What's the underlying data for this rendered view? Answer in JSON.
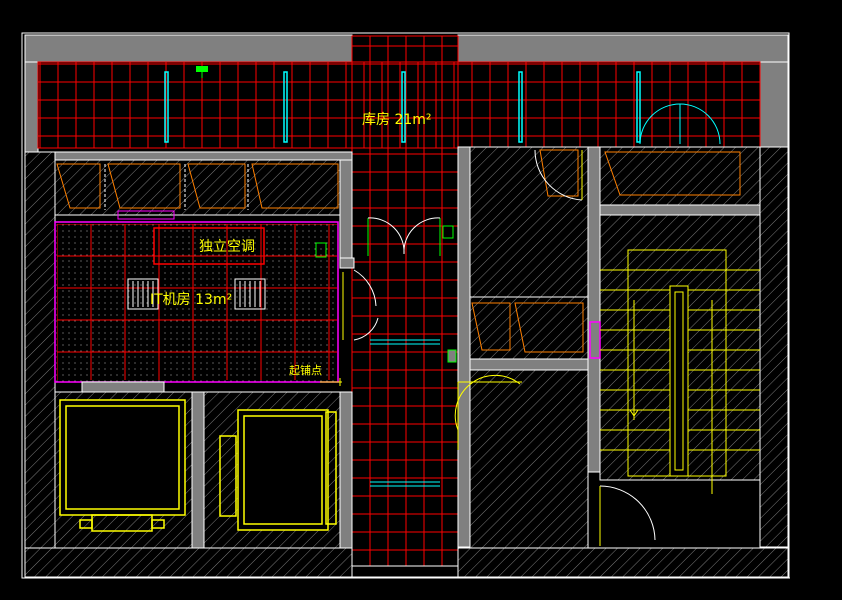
{
  "labels": {
    "storeroom": "库房 21m²",
    "it_room": "IT机房 13m²",
    "ac": "独立空调",
    "start_point": "起铺点"
  },
  "colors": {
    "background": "#000000",
    "wall_fill": "#808080",
    "grid_red": "#ff0000",
    "text_yellow": "#ffff00",
    "equipment_yellow": "#ffff00",
    "door_cyan": "#00ffff",
    "white": "#ffffff",
    "magenta": "#ff00ff",
    "green": "#00ff00",
    "orange": "#ff8000"
  }
}
